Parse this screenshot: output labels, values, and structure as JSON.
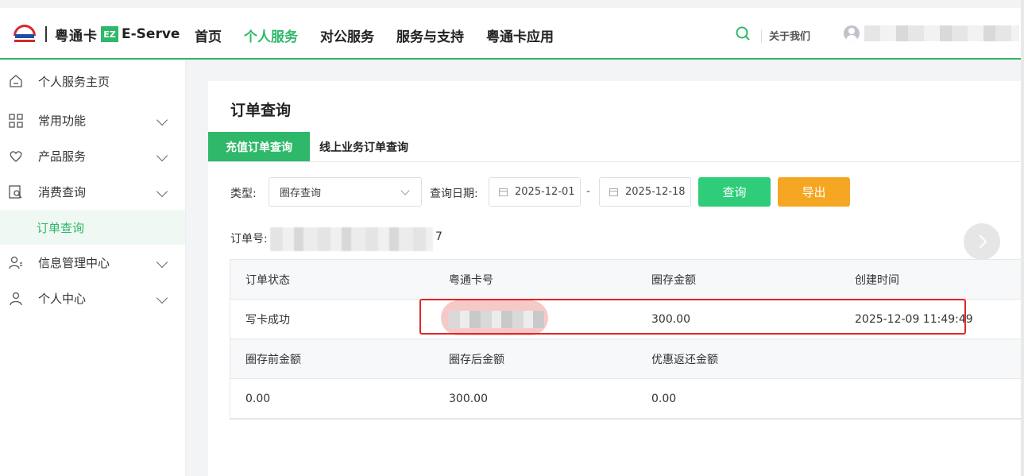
{
  "header": {
    "brand_name": "粤通卡",
    "brand_mark": "EZ",
    "brand_eserve": "E-Serve",
    "nav": [
      "首页",
      "个人服务",
      "对公服务",
      "服务与支持",
      "粤通卡应用"
    ],
    "nav_active_index": 1,
    "about": "关于我们"
  },
  "sidebar": {
    "items": [
      {
        "label": "个人服务主页",
        "icon": "home-icon"
      },
      {
        "label": "常用功能",
        "icon": "grid-icon"
      },
      {
        "label": "产品服务",
        "icon": "heart-hand-icon"
      },
      {
        "label": "消费查询",
        "icon": "search-doc-icon"
      },
      {
        "label": "订单查询",
        "icon": ""
      },
      {
        "label": "信息管理中心",
        "icon": "user-list-icon"
      },
      {
        "label": "个人中心",
        "icon": "user-icon"
      }
    ],
    "active_sub": "订单查询"
  },
  "main": {
    "title": "订单查询",
    "tabs": [
      "充值订单查询",
      "线上业务订单查询"
    ],
    "filters": {
      "type_label": "类型:",
      "type_value": "圈存查询",
      "date_label": "查询日期:",
      "date_start": "2025-12-01",
      "date_sep": "-",
      "date_end": "2025-12-18",
      "query_button": "查询",
      "export_button": "导出"
    },
    "order_no_label": "订单号:",
    "order_no_tail": "7",
    "table": {
      "head1": [
        "订单状态",
        "粤通卡号",
        "圈存金额",
        "创建时间"
      ],
      "row1": [
        "写卡成功",
        "",
        "300.00",
        "2025-12-09 11:49:49"
      ],
      "head2": [
        "圈存前金额",
        "圈存后金额",
        "优惠返还金额"
      ],
      "row2": [
        "0.00",
        "300.00",
        "0.00"
      ]
    }
  },
  "colors": {
    "accent": "#2fb86a",
    "query_button": "#2fcc7a",
    "export_button": "#f5a623",
    "highlight": "#e22525"
  }
}
